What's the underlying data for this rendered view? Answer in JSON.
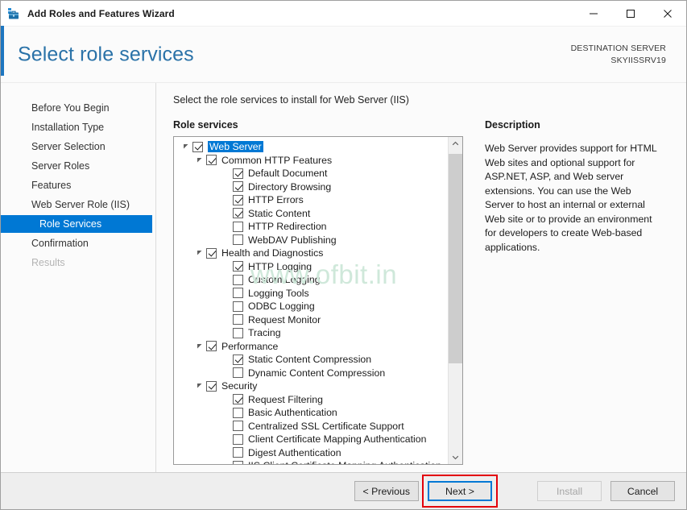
{
  "window": {
    "title": "Add Roles and Features Wizard",
    "icon": "server-toolbox-icon",
    "minimize_label": "Minimize",
    "maximize_label": "Maximize",
    "close_label": "Close"
  },
  "header": {
    "page_title": "Select role services",
    "destination_label": "DESTINATION SERVER",
    "destination_name": "SKYIISSRV19",
    "accent_color": "#1d76c0"
  },
  "nav": {
    "items": [
      {
        "label": "Before You Begin",
        "state": "normal",
        "sub": false
      },
      {
        "label": "Installation Type",
        "state": "normal",
        "sub": false
      },
      {
        "label": "Server Selection",
        "state": "normal",
        "sub": false
      },
      {
        "label": "Server Roles",
        "state": "normal",
        "sub": false
      },
      {
        "label": "Features",
        "state": "normal",
        "sub": false
      },
      {
        "label": "Web Server Role (IIS)",
        "state": "normal",
        "sub": false
      },
      {
        "label": "Role Services",
        "state": "selected",
        "sub": true
      },
      {
        "label": "Confirmation",
        "state": "normal",
        "sub": false
      },
      {
        "label": "Results",
        "state": "disabled",
        "sub": false
      }
    ],
    "selected_color": "#0078d4"
  },
  "main": {
    "instruction": "Select the role services to install for Web Server (IIS)",
    "section_label": "Role services",
    "watermark": "www.ofbit.in",
    "watermark_color": "#cfe8da",
    "tree": [
      {
        "label": "Web Server",
        "level": 0,
        "checked": true,
        "twisty": "expanded",
        "selected": true
      },
      {
        "label": "Common HTTP Features",
        "level": 1,
        "checked": true,
        "twisty": "expanded",
        "selected": false
      },
      {
        "label": "Default Document",
        "level": 2,
        "checked": true,
        "twisty": "none",
        "selected": false
      },
      {
        "label": "Directory Browsing",
        "level": 2,
        "checked": true,
        "twisty": "none",
        "selected": false
      },
      {
        "label": "HTTP Errors",
        "level": 2,
        "checked": true,
        "twisty": "none",
        "selected": false
      },
      {
        "label": "Static Content",
        "level": 2,
        "checked": true,
        "twisty": "none",
        "selected": false
      },
      {
        "label": "HTTP Redirection",
        "level": 2,
        "checked": false,
        "twisty": "none",
        "selected": false
      },
      {
        "label": "WebDAV Publishing",
        "level": 2,
        "checked": false,
        "twisty": "none",
        "selected": false
      },
      {
        "label": "Health and Diagnostics",
        "level": 1,
        "checked": true,
        "twisty": "expanded",
        "selected": false
      },
      {
        "label": "HTTP Logging",
        "level": 2,
        "checked": true,
        "twisty": "none",
        "selected": false
      },
      {
        "label": "Custom Logging",
        "level": 2,
        "checked": false,
        "twisty": "none",
        "selected": false
      },
      {
        "label": "Logging Tools",
        "level": 2,
        "checked": false,
        "twisty": "none",
        "selected": false
      },
      {
        "label": "ODBC Logging",
        "level": 2,
        "checked": false,
        "twisty": "none",
        "selected": false
      },
      {
        "label": "Request Monitor",
        "level": 2,
        "checked": false,
        "twisty": "none",
        "selected": false
      },
      {
        "label": "Tracing",
        "level": 2,
        "checked": false,
        "twisty": "none",
        "selected": false
      },
      {
        "label": "Performance",
        "level": 1,
        "checked": true,
        "twisty": "expanded",
        "selected": false
      },
      {
        "label": "Static Content Compression",
        "level": 2,
        "checked": true,
        "twisty": "none",
        "selected": false
      },
      {
        "label": "Dynamic Content Compression",
        "level": 2,
        "checked": false,
        "twisty": "none",
        "selected": false
      },
      {
        "label": "Security",
        "level": 1,
        "checked": true,
        "twisty": "expanded",
        "selected": false
      },
      {
        "label": "Request Filtering",
        "level": 2,
        "checked": true,
        "twisty": "none",
        "selected": false
      },
      {
        "label": "Basic Authentication",
        "level": 2,
        "checked": false,
        "twisty": "none",
        "selected": false
      },
      {
        "label": "Centralized SSL Certificate Support",
        "level": 2,
        "checked": false,
        "twisty": "none",
        "selected": false
      },
      {
        "label": "Client Certificate Mapping Authentication",
        "level": 2,
        "checked": false,
        "twisty": "none",
        "selected": false
      },
      {
        "label": "Digest Authentication",
        "level": 2,
        "checked": false,
        "twisty": "none",
        "selected": false
      },
      {
        "label": "IIS Client Certificate Mapping Authentication",
        "level": 2,
        "checked": false,
        "twisty": "none",
        "selected": false
      }
    ],
    "scrollbar": {
      "up_arrow": "chevron-up-icon",
      "down_arrow": "chevron-down-icon",
      "thumb_top_pct": 1,
      "thumb_height_pct": 70
    }
  },
  "description": {
    "title": "Description",
    "text": "Web Server provides support for HTML Web sites and optional support for ASP.NET, ASP, and Web server extensions. You can use the Web Server to host an internal or external Web site or to provide an environment for developers to create Web-based applications."
  },
  "footer": {
    "previous_label": "< Previous",
    "next_label": "Next >",
    "install_label": "Install",
    "cancel_label": "Cancel",
    "next_focused": true,
    "install_disabled": true,
    "highlight_color": "#e3000b",
    "focus_color": "#0078d4"
  }
}
